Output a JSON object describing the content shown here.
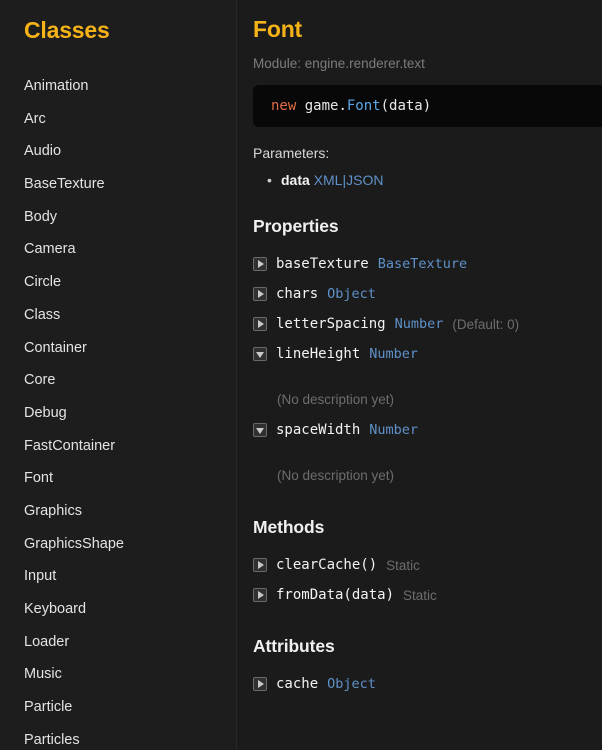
{
  "sidebar": {
    "title": "Classes",
    "items": [
      {
        "label": "Animation"
      },
      {
        "label": "Arc"
      },
      {
        "label": "Audio"
      },
      {
        "label": "BaseTexture"
      },
      {
        "label": "Body"
      },
      {
        "label": "Camera"
      },
      {
        "label": "Circle"
      },
      {
        "label": "Class"
      },
      {
        "label": "Container"
      },
      {
        "label": "Core"
      },
      {
        "label": "Debug"
      },
      {
        "label": "FastContainer"
      },
      {
        "label": "Font"
      },
      {
        "label": "Graphics"
      },
      {
        "label": "GraphicsShape"
      },
      {
        "label": "Input"
      },
      {
        "label": "Keyboard"
      },
      {
        "label": "Loader"
      },
      {
        "label": "Music"
      },
      {
        "label": "Particle"
      },
      {
        "label": "Particles"
      }
    ]
  },
  "main": {
    "title": "Font",
    "module_line": "Module: engine.renderer.text",
    "code": {
      "keyword": "new",
      "namespace": " game.",
      "class": "Font",
      "args": "(data)"
    },
    "parameters_label": "Parameters:",
    "parameters": [
      {
        "name": "data",
        "type": "XML|JSON"
      }
    ],
    "properties_heading": "Properties",
    "properties": [
      {
        "toggle": "collapsed",
        "name": "baseTexture",
        "type": "BaseTexture",
        "meta": "",
        "description": ""
      },
      {
        "toggle": "collapsed",
        "name": "chars",
        "type": "Object",
        "meta": "",
        "description": ""
      },
      {
        "toggle": "collapsed",
        "name": "letterSpacing",
        "type": "Number",
        "meta": "(Default: 0)",
        "description": ""
      },
      {
        "toggle": "expanded",
        "name": "lineHeight",
        "type": "Number",
        "meta": "",
        "description": "(No description yet)"
      },
      {
        "toggle": "expanded",
        "name": "spaceWidth",
        "type": "Number",
        "meta": "",
        "description": "(No description yet)"
      }
    ],
    "methods_heading": "Methods",
    "methods": [
      {
        "toggle": "collapsed",
        "name": "clearCache()",
        "type": "",
        "meta": "Static"
      },
      {
        "toggle": "collapsed",
        "name": "fromData(data)",
        "type": "",
        "meta": "Static"
      }
    ],
    "attributes_heading": "Attributes",
    "attributes": [
      {
        "toggle": "collapsed",
        "name": "cache",
        "type": "Object",
        "meta": ""
      }
    ]
  },
  "colors": {
    "accent": "#f5b318",
    "type_link": "#5f91c9",
    "muted": "#6d6d6d",
    "sidebar_bg": "#1d1d1d",
    "main_bg": "#1b1b1b",
    "code_bg": "#080808"
  }
}
